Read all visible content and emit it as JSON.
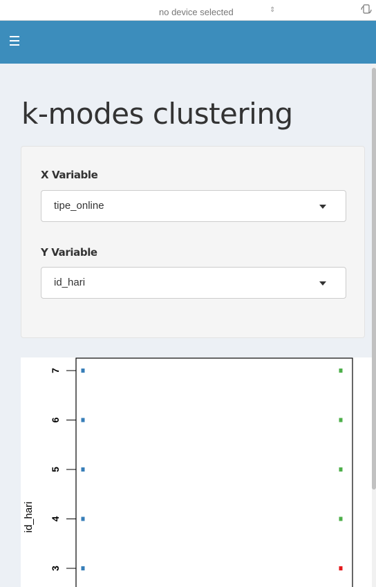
{
  "device_bar": {
    "selected_text": "no device selected",
    "arrows": "⇕",
    "icon": "device-rotate-icon"
  },
  "navbar": {
    "menu_icon": "hamburger-icon",
    "color": "#3c8dbc"
  },
  "page": {
    "title": "k-modes clustering"
  },
  "controls": {
    "x_variable": {
      "label": "X Variable",
      "value": "tipe_online"
    },
    "y_variable": {
      "label": "Y Variable",
      "value": "id_hari"
    }
  },
  "chart_data": {
    "type": "scatter",
    "ylabel": "id_hari",
    "y_ticks": [
      "3",
      "4",
      "5",
      "6",
      "7"
    ],
    "series": [
      {
        "color": "#377eb8",
        "points": [
          {
            "x": "left",
            "y": 7
          },
          {
            "x": "left",
            "y": 6
          },
          {
            "x": "left",
            "y": 5
          },
          {
            "x": "left",
            "y": 4
          },
          {
            "x": "left",
            "y": 3
          }
        ]
      },
      {
        "color": "#4daf4a",
        "points": [
          {
            "x": "right",
            "y": 7
          },
          {
            "x": "right",
            "y": 6
          },
          {
            "x": "right",
            "y": 5
          },
          {
            "x": "right",
            "y": 4
          }
        ]
      },
      {
        "color": "#e41a1c",
        "points": [
          {
            "x": "right",
            "y": 3
          }
        ]
      }
    ]
  }
}
